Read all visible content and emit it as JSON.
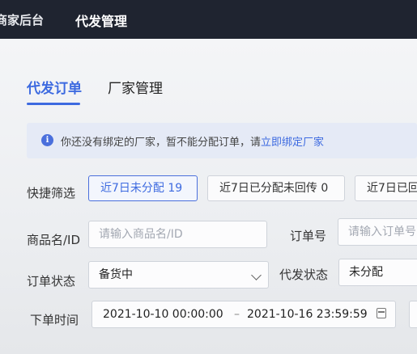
{
  "topbar": {
    "merchant_label": "商家后台",
    "module_title": "代发管理"
  },
  "tabs": [
    {
      "label": "代发订单",
      "active": true
    },
    {
      "label": "厂家管理",
      "active": false
    }
  ],
  "notice": {
    "icon": "info-icon",
    "text": "你还没有绑定的厂家，暂不能分配订单，请",
    "link": "立即绑定厂家"
  },
  "quick_filter": {
    "label": "快捷筛选",
    "chips": [
      {
        "label": "近7日未分配 19",
        "active": true
      },
      {
        "label": "近7日已分配未回传 0",
        "active": false
      },
      {
        "label": "近7日已回",
        "active": false
      }
    ]
  },
  "product": {
    "label": "商品名/ID",
    "placeholder": "请输入商品名/ID"
  },
  "order_no": {
    "label": "订单号",
    "placeholder": "请输入订单号"
  },
  "order_status": {
    "label": "订单状态",
    "value": "备货中"
  },
  "dropship_status": {
    "label": "代发状态",
    "value": "未分配"
  },
  "order_time": {
    "label": "下单时间",
    "start": "2021-10-10 00:00:00",
    "separator": "–",
    "end": "2021-10-16 23:59:59"
  },
  "colors": {
    "accent": "#3d6ae0",
    "topbar": "#1f2430",
    "notice_bg": "#e5eaf6"
  }
}
